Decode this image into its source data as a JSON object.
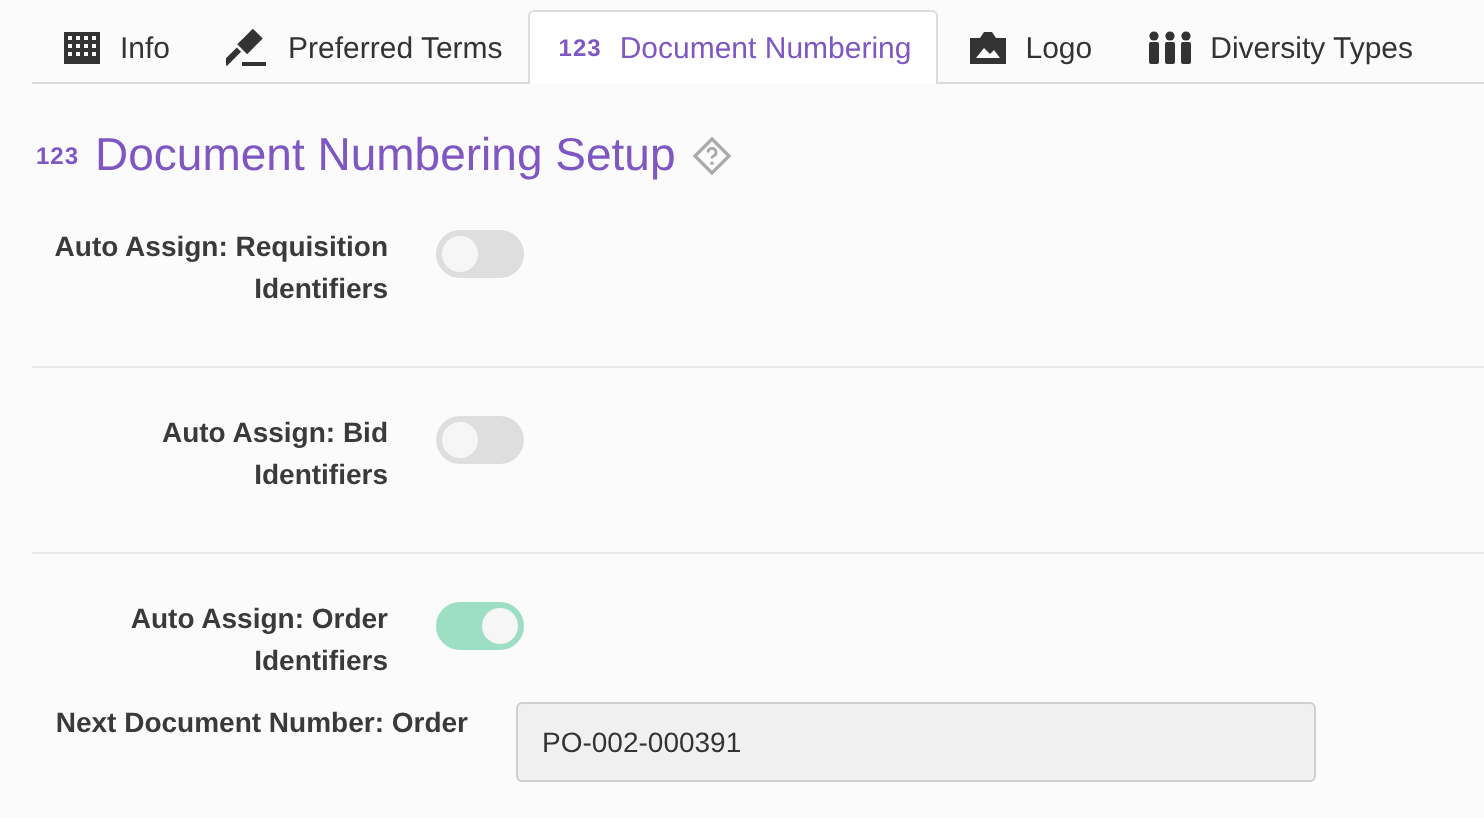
{
  "tabs": [
    {
      "kind": "building",
      "label": "Info",
      "selected": false
    },
    {
      "kind": "gavel",
      "label": "Preferred Terms",
      "selected": false
    },
    {
      "kind": "numbers",
      "icon_text": "123",
      "label": "Document Numbering",
      "selected": true
    },
    {
      "kind": "image",
      "label": "Logo",
      "selected": false
    },
    {
      "kind": "people",
      "label": "Diversity Types",
      "selected": false
    }
  ],
  "heading": {
    "icon_text": "123",
    "title": "Document Numbering Setup"
  },
  "settings": [
    {
      "label": "Auto Assign: Requisition Identifiers",
      "on": false
    },
    {
      "label": "Auto Assign: Bid Identifiers",
      "on": false
    },
    {
      "label": "Auto Assign: Order Identifiers",
      "on": true,
      "field": {
        "label": "Next Document Number: Order",
        "value": "PO-002-000391"
      }
    }
  ]
}
